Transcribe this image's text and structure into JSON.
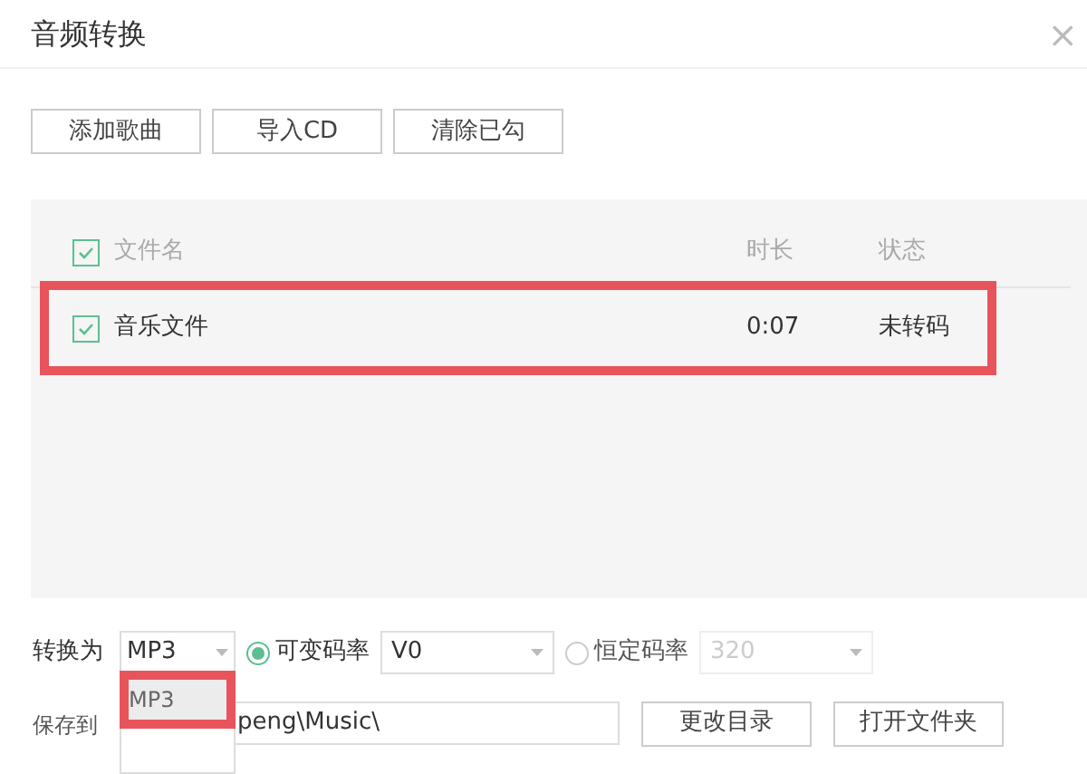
{
  "window": {
    "title": "音频转换",
    "close": "×"
  },
  "toolbar": [
    "添加歌曲",
    "导入CD",
    "清除已勾"
  ],
  "table": {
    "header": {
      "checked": true,
      "columns": [
        "文件名",
        "时长",
        "状态"
      ]
    },
    "rows": [
      {
        "checked": true,
        "name": "音乐文件",
        "duration": "0:07",
        "status": "未转码",
        "highlighted": true
      }
    ]
  },
  "convert": {
    "label": "转换为",
    "format": "MP3",
    "dropdown_open": true,
    "options": [
      {
        "label": "MP3",
        "selected": true,
        "highlighted": true
      }
    ],
    "modes": [
      {
        "label": "可变码率",
        "selected": true,
        "value": "V0",
        "disabled": false
      },
      {
        "label": "恒定码率",
        "selected": false,
        "value": "320",
        "disabled": true
      }
    ]
  },
  "save": {
    "label": "保存到",
    "path": "peng\\Music\\",
    "buttons": [
      "更改目录",
      "打开文件夹"
    ]
  }
}
